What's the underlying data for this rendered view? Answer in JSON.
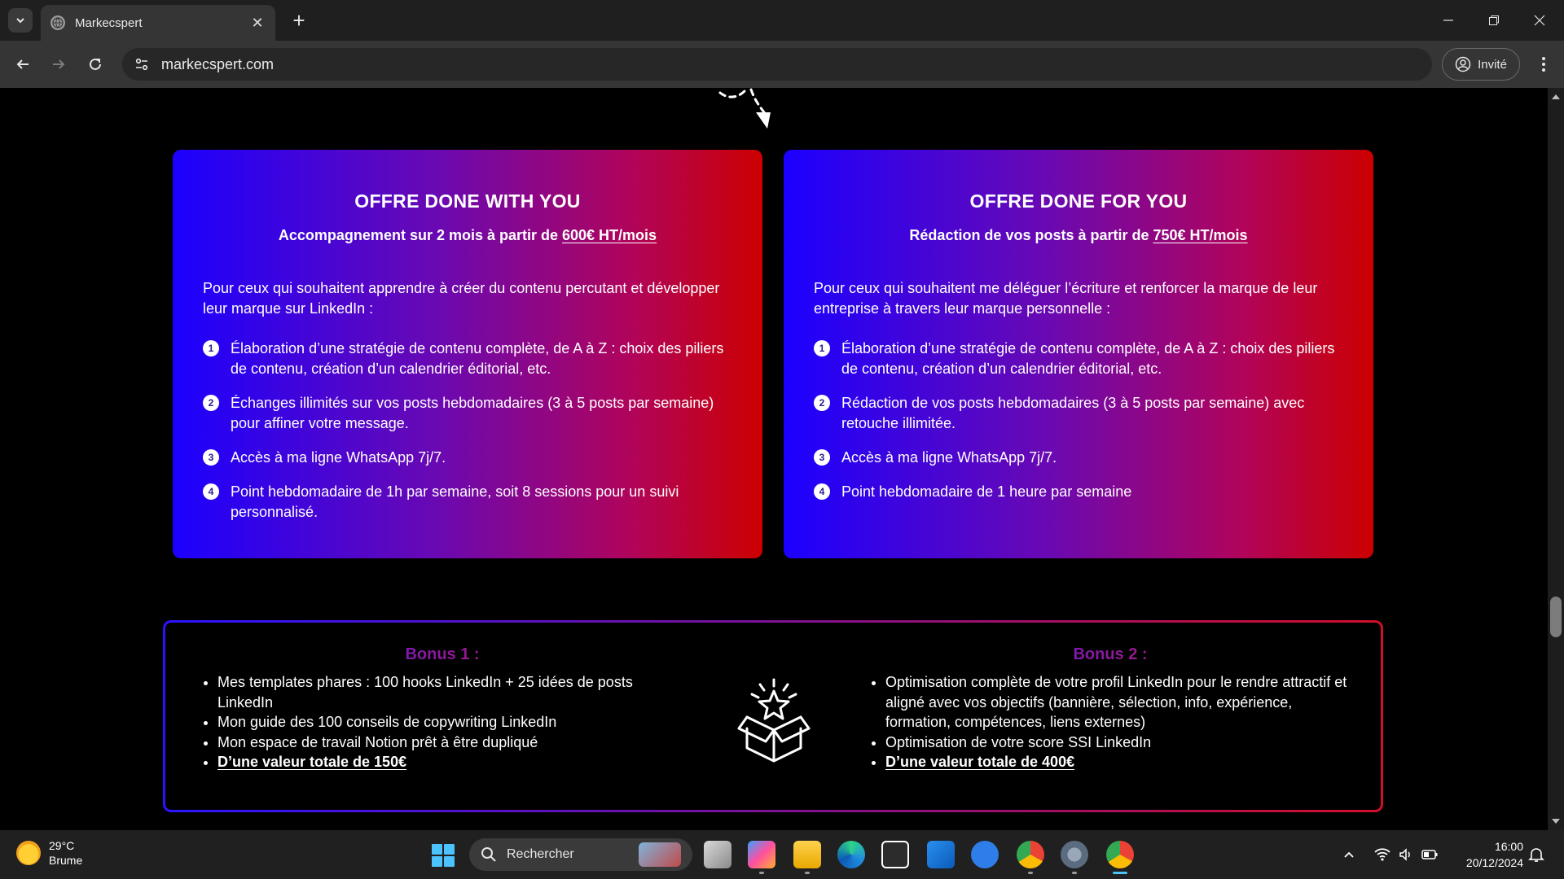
{
  "browser": {
    "tab_title": "Markecspert",
    "tab_close": "✕",
    "new_tab": "+",
    "url": "markecspert.com",
    "profile_label": "Invité"
  },
  "offers": [
    {
      "title": "OFFRE DONE WITH YOU",
      "subtitle_prefix": "Accompagnement sur 2 mois à partir de ",
      "price": "600€ HT/mois",
      "intro": "Pour ceux qui souhaitent apprendre à créer du contenu percutant et développer leur marque sur LinkedIn :",
      "items": [
        {
          "num": "1",
          "text": "Élaboration d’une stratégie de contenu complète, de A à Z : choix des piliers de contenu, création d’un calendrier éditorial, etc."
        },
        {
          "num": "2",
          "text": "Échanges illimités sur vos posts hebdomadaires (3 à 5 posts par semaine) pour affiner votre message."
        },
        {
          "num": "3",
          "text": "Accès à ma ligne WhatsApp 7j/7."
        },
        {
          "num": "4",
          "text": "Point hebdomadaire de 1h par semaine, soit 8 sessions pour un suivi personnalisé."
        }
      ]
    },
    {
      "title": "OFFRE DONE FOR YOU",
      "subtitle_prefix": "Rédaction de vos posts à partir de ",
      "price": "750€ HT/mois",
      "intro": "Pour ceux qui souhaitent me déléguer l’écriture et renforcer la marque de leur entreprise à travers leur marque personnelle :",
      "items": [
        {
          "num": "1",
          "text": "Élaboration d’une stratégie de contenu complète, de A à Z : choix des piliers de contenu, création d’un calendrier éditorial, etc."
        },
        {
          "num": "2",
          "text": "Rédaction de vos posts hebdomadaires (3 à 5 posts par semaine) avec retouche illimitée."
        },
        {
          "num": "3",
          "text": "Accès à ma ligne WhatsApp 7j/7."
        },
        {
          "num": "4",
          "text": "Point hebdomadaire de 1 heure par semaine"
        }
      ]
    }
  ],
  "bonuses": [
    {
      "title": "Bonus 1 :",
      "items": [
        "Mes templates phares : 100 hooks LinkedIn + 25 idées de posts LinkedIn",
        "Mon guide des 100 conseils de copywriting LinkedIn",
        "Mon espace de travail Notion prêt à être dupliqué"
      ],
      "value": "D’une valeur totale de 150€"
    },
    {
      "title": "Bonus 2 :",
      "items": [
        "Optimisation complète de votre profil LinkedIn pour le rendre attractif et aligné avec vos objectifs (bannière, sélection, info, expérience, formation, compétences, liens externes)",
        "Optimisation de votre score SSI LinkedIn"
      ],
      "value": "D’une valeur totale de 400€"
    }
  ],
  "taskbar": {
    "weather_temp": "29°C",
    "weather_desc": "Brume",
    "search_placeholder": "Rechercher",
    "time": "16:00",
    "date": "20/12/2024"
  },
  "colors": {
    "gradient_start": "#1b00ff",
    "gradient_end": "#cc0000",
    "taskbar_accent": "#4cc2ff"
  }
}
